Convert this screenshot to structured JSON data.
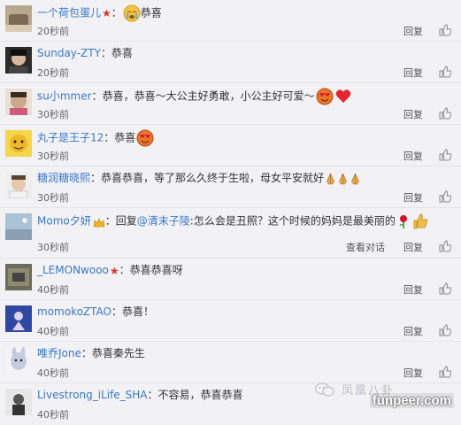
{
  "comments": [
    {
      "user": "一个荷包蛋儿",
      "text": "恭喜",
      "time": "20秒前",
      "reply": "回复",
      "badge": "red-star",
      "emoji": "crying-face"
    },
    {
      "user": "Sunday-ZTY",
      "text": "恭喜",
      "time": "20秒前",
      "reply": "回复"
    },
    {
      "user": "su小mmer",
      "text": "恭喜，恭喜～大公主好勇敢，小公主好可爱～",
      "time": "30秒前",
      "reply": "回复",
      "emoji": "heart-eyes-and-heart"
    },
    {
      "user": "丸子是王子12",
      "text": "恭喜",
      "time": "30秒前",
      "reply": "回复",
      "emoji": "heart-eyes"
    },
    {
      "user": "糖润糖晓熙",
      "text": "恭喜恭喜，等了那么久终于生啦，母女平安就好",
      "time": "30秒前",
      "reply": "回复",
      "emoji": "praying-hands-x3"
    },
    {
      "user": "Momo夕妍",
      "prefix": "回复",
      "mention": "@清末子陵",
      "text": ":怎么会是丑照？这个时候的妈妈是最美丽的",
      "time": "30秒前",
      "view_conversation": "查看对话",
      "reply": "回复",
      "badge": "crown",
      "emoji": "rose-and-thumbs-up"
    },
    {
      "user": "_LEMONwooo",
      "text": "恭喜恭喜呀",
      "time": "40秒前",
      "reply": "回复",
      "badge": "red-star"
    },
    {
      "user": "momokoZTAO",
      "text": "恭喜！",
      "time": "40秒前",
      "reply": "回复"
    },
    {
      "user": "唯乔Jone",
      "text": "恭喜秦先生",
      "time": "40秒前",
      "reply": "回复"
    },
    {
      "user": "Livestrong_iLife_SHA",
      "text": "不容易，恭喜恭喜",
      "time": "40秒前",
      "reply": "回复"
    }
  ],
  "separator": "：",
  "watermark": {
    "text": "凤凰八卦",
    "site": "funpeer.com"
  },
  "colors": {
    "username": "#3a77c7",
    "background": "#f2f2f5",
    "divider": "#e4e4ea"
  }
}
